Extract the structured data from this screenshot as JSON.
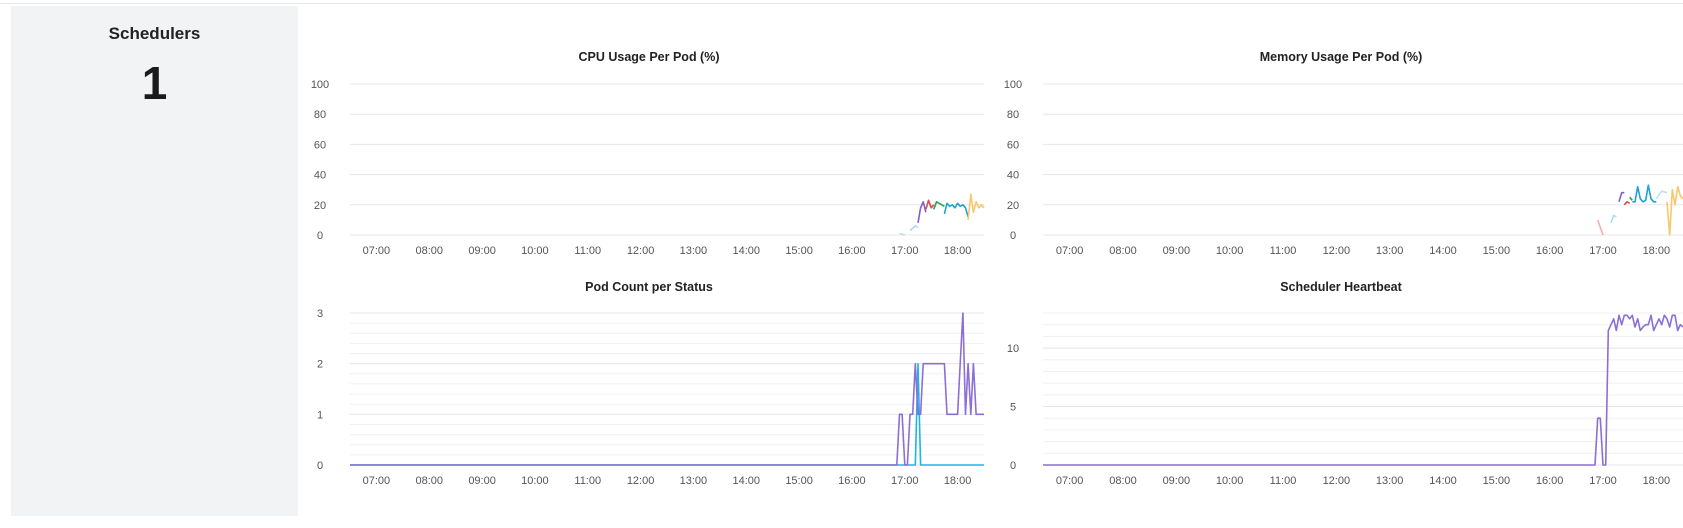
{
  "stat": {
    "title": "Schedulers",
    "value": "1"
  },
  "chart_data": [
    {
      "id": "cpu",
      "type": "line",
      "title": "CPU Usage Per Pod (%)",
      "xlabel": "",
      "ylabel": "",
      "x_ticks": [
        "07:00",
        "08:00",
        "09:00",
        "10:00",
        "11:00",
        "12:00",
        "13:00",
        "14:00",
        "15:00",
        "16:00",
        "17:00",
        "18:00"
      ],
      "xlim": [
        6.5,
        18.5
      ],
      "ylim": [
        0,
        100
      ],
      "y_ticks": [
        0,
        20,
        40,
        60,
        80,
        100
      ],
      "grid": true,
      "series": [
        {
          "color": "#b7e3d0",
          "x": [
            16.9,
            17.0
          ],
          "y": [
            1,
            0
          ]
        },
        {
          "color": "#a8dcef",
          "x": [
            17.1,
            17.2,
            17.25
          ],
          "y": [
            3,
            6,
            5
          ]
        },
        {
          "color": "#7f5ecf",
          "x": [
            17.25,
            17.3,
            17.35,
            17.4
          ],
          "y": [
            8,
            18,
            22,
            15
          ]
        },
        {
          "color": "#d94c4c",
          "x": [
            17.4,
            17.45,
            17.5,
            17.55
          ],
          "y": [
            17,
            23,
            18,
            20
          ]
        },
        {
          "color": "#2aa44f",
          "x": [
            17.55,
            17.6,
            17.7,
            17.75
          ],
          "y": [
            17,
            22,
            20,
            19
          ]
        },
        {
          "color": "#1fa3d6",
          "x": [
            17.75,
            17.8,
            17.85,
            17.9,
            17.95,
            18.0,
            18.05,
            18.1,
            18.15,
            18.2
          ],
          "y": [
            14,
            21,
            19,
            20,
            18,
            21,
            19,
            20,
            18,
            12
          ]
        },
        {
          "color": "#f7c86a",
          "x": [
            18.2,
            18.25,
            18.3,
            18.35,
            18.4,
            18.45,
            18.5
          ],
          "y": [
            10,
            27,
            15,
            22,
            18,
            20,
            18
          ]
        }
      ]
    },
    {
      "id": "memory",
      "type": "line",
      "title": "Memory Usage Per Pod (%)",
      "xlabel": "",
      "ylabel": "",
      "x_ticks": [
        "07:00",
        "08:00",
        "09:00",
        "10:00",
        "11:00",
        "12:00",
        "13:00",
        "14:00",
        "15:00",
        "16:00",
        "17:00",
        "18:00"
      ],
      "xlim": [
        6.5,
        18.5
      ],
      "ylim": [
        0,
        100
      ],
      "y_ticks": [
        0,
        20,
        40,
        60,
        80,
        100
      ],
      "grid": true,
      "series": [
        {
          "color": "#f2b0a8",
          "x": [
            16.9,
            16.95,
            17.0
          ],
          "y": [
            10,
            5,
            0
          ]
        },
        {
          "color": "#a8dcef",
          "x": [
            17.15,
            17.2,
            17.25
          ],
          "y": [
            8,
            13,
            12
          ]
        },
        {
          "color": "#7f5ecf",
          "x": [
            17.3,
            17.35,
            17.4
          ],
          "y": [
            22,
            28,
            28
          ]
        },
        {
          "color": "#d94c4c",
          "x": [
            17.4,
            17.45,
            17.5
          ],
          "y": [
            20,
            22,
            21
          ]
        },
        {
          "color": "#2aa44f",
          "x": [
            17.5,
            17.55
          ],
          "y": [
            25,
            23
          ]
        },
        {
          "color": "#1fa3d6",
          "x": [
            17.55,
            17.6,
            17.65,
            17.7,
            17.75,
            17.8,
            17.85,
            17.9,
            17.95,
            18.0
          ],
          "y": [
            22,
            22,
            32,
            24,
            22,
            23,
            33,
            24,
            22,
            22
          ]
        },
        {
          "color": "#b8e3f3",
          "x": [
            18.0,
            18.1,
            18.2
          ],
          "y": [
            24,
            29,
            28
          ]
        },
        {
          "color": "#f7c86a",
          "x": [
            18.2,
            18.25,
            18.3,
            18.35,
            18.4,
            18.45,
            18.5
          ],
          "y": [
            22,
            0,
            30,
            20,
            32,
            26,
            24
          ]
        }
      ]
    },
    {
      "id": "podcount",
      "type": "line",
      "title": "Pod Count per Status",
      "xlabel": "",
      "ylabel": "",
      "x_ticks": [
        "07:00",
        "08:00",
        "09:00",
        "10:00",
        "11:00",
        "12:00",
        "13:00",
        "14:00",
        "15:00",
        "16:00",
        "17:00",
        "18:00"
      ],
      "xlim": [
        6.5,
        18.5
      ],
      "ylim": [
        0,
        3
      ],
      "y_ticks": [
        0,
        1,
        2,
        3
      ],
      "grid": true,
      "series": [
        {
          "color": "#1fb4e8",
          "x": [
            6.5,
            17.2,
            17.25,
            17.3,
            17.35,
            18.5
          ],
          "y": [
            0,
            0,
            2,
            0,
            0,
            0
          ]
        },
        {
          "color": "#8b6fd6",
          "x": [
            6.5,
            16.85,
            16.9,
            16.95,
            17.0,
            17.05,
            17.1,
            17.15,
            17.2,
            17.25,
            17.3,
            17.35,
            17.4,
            17.75,
            17.8,
            17.85,
            17.9,
            17.95,
            18.0,
            18.05,
            18.1,
            18.15,
            18.2,
            18.25,
            18.3,
            18.35,
            18.4,
            18.45,
            18.5
          ],
          "y": [
            0,
            0,
            1,
            1,
            0,
            0,
            1,
            1,
            2,
            1,
            1,
            2,
            2,
            2,
            1,
            1,
            1,
            1,
            1,
            2,
            3,
            1,
            2,
            1,
            2,
            1,
            1,
            1,
            1
          ]
        }
      ]
    },
    {
      "id": "heartbeat",
      "type": "line",
      "title": "Scheduler Heartbeat",
      "xlabel": "",
      "ylabel": "",
      "x_ticks": [
        "07:00",
        "08:00",
        "09:00",
        "10:00",
        "11:00",
        "12:00",
        "13:00",
        "14:00",
        "15:00",
        "16:00",
        "17:00",
        "18:00"
      ],
      "xlim": [
        6.5,
        18.5
      ],
      "ylim": [
        0,
        13
      ],
      "y_ticks": [
        0,
        5,
        10
      ],
      "grid": true,
      "series": [
        {
          "color": "#8b6fd6",
          "x": [
            6.5,
            16.85,
            16.9,
            16.95,
            17.0,
            17.05,
            17.1,
            17.15,
            17.2,
            17.25,
            17.3,
            17.35,
            17.4,
            17.45,
            17.5,
            17.55,
            17.6,
            17.65,
            17.7,
            17.75,
            17.8,
            17.85,
            17.9,
            17.95,
            18.0,
            18.05,
            18.1,
            18.15,
            18.2,
            18.25,
            18.3,
            18.35,
            18.4,
            18.45,
            18.5
          ],
          "y": [
            0,
            0,
            4,
            4,
            0,
            0,
            11.5,
            12,
            12.5,
            11.5,
            12.8,
            12,
            12.8,
            12.8,
            12.5,
            12.8,
            11.8,
            12.5,
            11.5,
            11.8,
            12,
            12,
            12.8,
            11.5,
            12,
            12.5,
            12,
            12.8,
            12.5,
            11.8,
            12.8,
            12.8,
            11.5,
            12,
            11.8
          ]
        }
      ]
    }
  ]
}
